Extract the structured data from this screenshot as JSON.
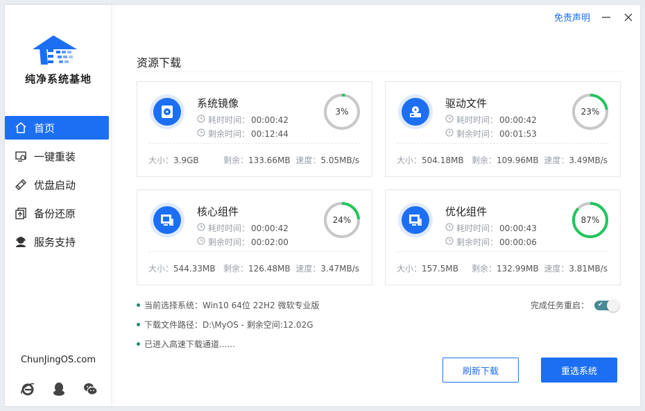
{
  "brand": "纯净系统基地",
  "site": "ChunJingOS.com",
  "disclaimer": "免责声明",
  "nav": [
    {
      "label": "首页",
      "icon": "home-icon",
      "active": true
    },
    {
      "label": "一键重装",
      "icon": "reinstall-icon",
      "active": false
    },
    {
      "label": "优盘启动",
      "icon": "usb-icon",
      "active": false
    },
    {
      "label": "备份还原",
      "icon": "backup-icon",
      "active": false
    },
    {
      "label": "服务支持",
      "icon": "support-icon",
      "active": false
    }
  ],
  "section_title": "资源下载",
  "labels": {
    "elapsed": "耗时时间：",
    "remaining": "剩余时间：",
    "size": "大小：",
    "left": "剩余：",
    "speed": "速度："
  },
  "cards": [
    {
      "name": "系统镜像",
      "icon": "disc-image-icon",
      "elapsed": "00:00:42",
      "remaining": "00:12:44",
      "percent": 3,
      "percent_label": "3%",
      "size": "3.9GB",
      "left": "133.66MB",
      "speed": "5.05MB/s",
      "ring_color": "#22c55e"
    },
    {
      "name": "驱动文件",
      "icon": "drive-icon",
      "elapsed": "00:00:42",
      "remaining": "00:01:53",
      "percent": 23,
      "percent_label": "23%",
      "size": "504.18MB",
      "left": "109.96MB",
      "speed": "3.49MB/s",
      "ring_color": "#22c55e"
    },
    {
      "name": "核心组件",
      "icon": "component-icon",
      "elapsed": "00:00:42",
      "remaining": "00:02:00",
      "percent": 24,
      "percent_label": "24%",
      "size": "544.33MB",
      "left": "126.48MB",
      "speed": "3.47MB/s",
      "ring_color": "#22c55e"
    },
    {
      "name": "优化组件",
      "icon": "optimize-icon",
      "elapsed": "00:00:43",
      "remaining": "00:00:06",
      "percent": 87,
      "percent_label": "87%",
      "size": "157.5MB",
      "left": "132.99MB",
      "speed": "3.81MB/s",
      "ring_color": "#22c55e"
    }
  ],
  "info": [
    "当前选择系统：Win10 64位 22H2 微软专业版",
    "下载文件路径：D:\\MyOS - 剩余空间:12.02G",
    "已进入高速下载通道......"
  ],
  "restart_label": "完成任务重启：",
  "restart_on": true,
  "buttons": {
    "refresh": "刷新下载",
    "reselect": "重选系统"
  },
  "colors": {
    "accent": "#1c6ff3",
    "progress": "#22c55e",
    "track": "#c8c8c8"
  }
}
